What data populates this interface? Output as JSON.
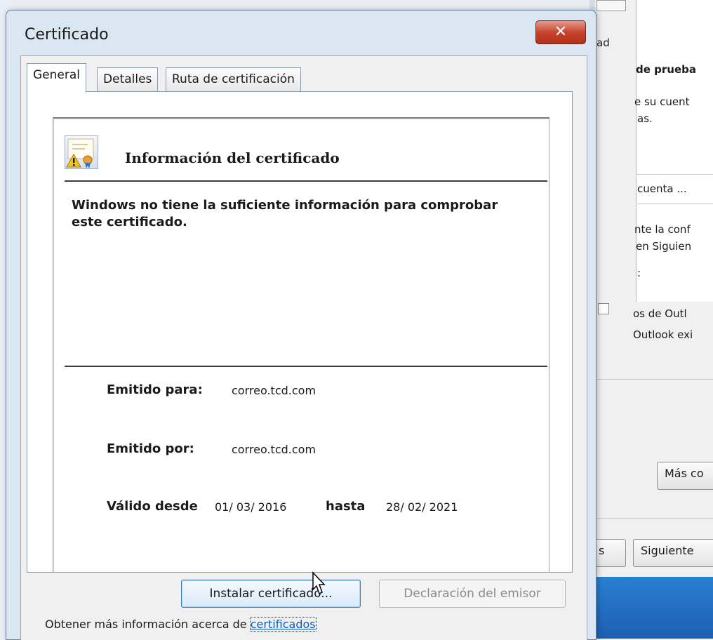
{
  "background_window": {
    "text_ad": "ad",
    "text_de_prueba": "de prueba",
    "text_su_cuenta": "e su cuent",
    "text_as": "as.",
    "button_cuenta": "cuenta ...",
    "text_la_conf": "nte la conf",
    "text_en_siguiente": "en Siguien",
    "text_colon": ":",
    "text_os_de_outlook": "os de Outl",
    "text_outlook_exi": "Outlook exi",
    "button_mas": "Más co",
    "button_s": "s",
    "button_siguiente": "Siguiente"
  },
  "dialog": {
    "title": "Certificado",
    "close_glyph": "✕",
    "tabs": [
      {
        "label": "General"
      },
      {
        "label": "Detalles"
      },
      {
        "label": "Ruta de certificación"
      }
    ],
    "heading": "Información del certificado",
    "warning": "Windows no tiene la suficiente información para comprobar este certificado.",
    "issued_to_label": "Emitido para:",
    "issued_to_value": "correo.tcd.com",
    "issued_by_label": "Emitido por:",
    "issued_by_value": "correo.tcd.com",
    "valid_from_label": "Válido desde",
    "valid_from_value": "01/ 03/ 2016",
    "valid_to_label": "hasta",
    "valid_to_value": "28/ 02/ 2021",
    "install_button": "Instalar certificado...",
    "issuer_statement_button": "Declaración del emisor",
    "footer_prefix": "Obtener más información acerca de ",
    "footer_link": "certificados"
  },
  "colors": {
    "title_bar": "#dbe6f3",
    "close_button": "#c8432d",
    "link": "#0e5bb5"
  }
}
